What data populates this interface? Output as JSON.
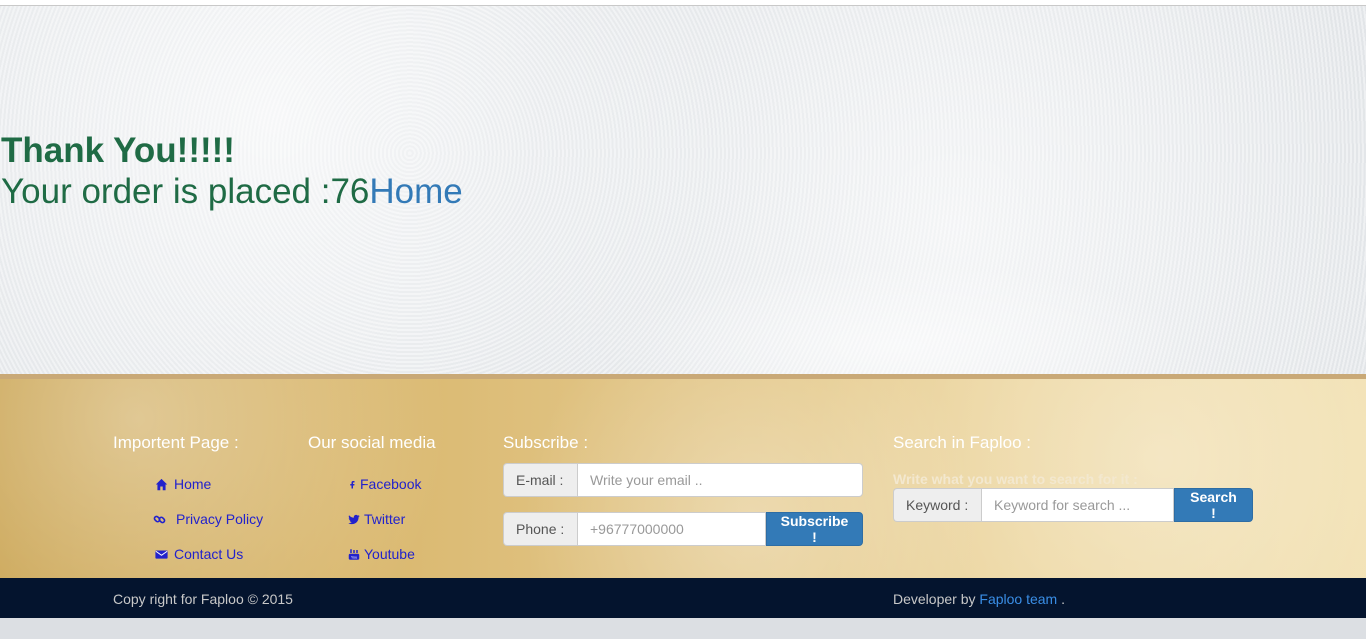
{
  "main": {
    "thank_you": "Thank You!!!!!",
    "order_text": "Your order is placed :76",
    "home_link": "Home"
  },
  "footer": {
    "important_pages": {
      "title": "Importent Page :",
      "links": [
        "Home",
        "Privacy Policy",
        "Contact Us"
      ]
    },
    "social": {
      "title": "Our social media",
      "links": [
        "Facebook",
        "Twitter",
        "Youtube"
      ]
    },
    "subscribe": {
      "title": "Subscribe :",
      "email_label": "E-mail :",
      "email_placeholder": "Write your email ..",
      "phone_label": "Phone :",
      "phone_placeholder": "+96777000000",
      "button": "Subscribe !"
    },
    "search": {
      "title": "Search in Faploo :",
      "hint": "Write what you want to search for it :",
      "keyword_label": "Keyword :",
      "keyword_placeholder": "Keyword for search ...",
      "button": "Search !"
    }
  },
  "bottom": {
    "copyright": "Copy right for Faploo © 2015",
    "developer_prefix": "Developer by",
    "developer_link": "Faploo team",
    "developer_suffix": "."
  },
  "colors": {
    "heading_green": "#1f6b45",
    "link_blue": "#337ab7",
    "footer_link": "#2222cc",
    "bottom_bar": "#04142e"
  },
  "icons": {
    "home": "home-icon",
    "privacy": "link-icon",
    "contact": "envelope-icon",
    "facebook": "facebook-icon",
    "twitter": "twitter-icon",
    "youtube": "youtube-icon"
  }
}
